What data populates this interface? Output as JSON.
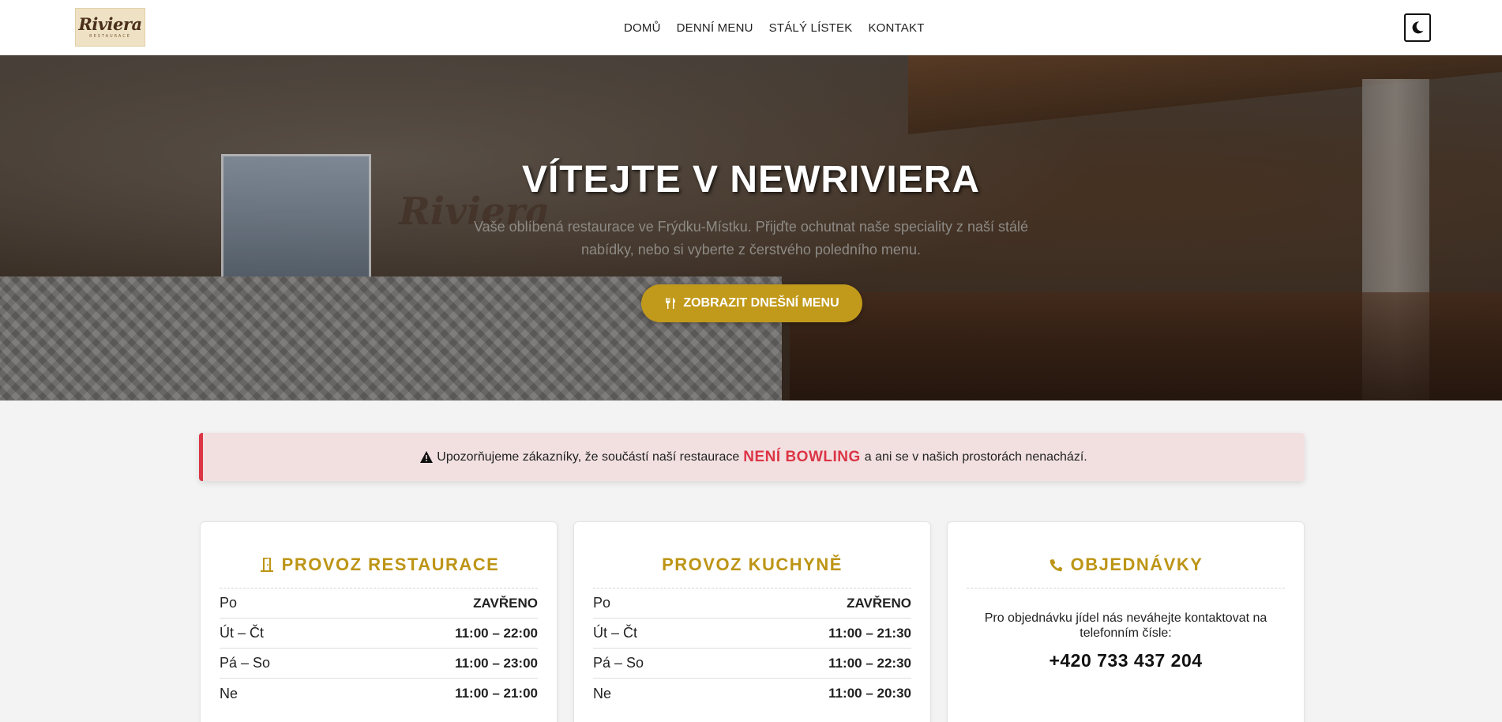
{
  "brand": {
    "logo_text": "Riviera",
    "logo_subtext": "RESTAURACE"
  },
  "nav": {
    "items": [
      "DOMŮ",
      "DENNÍ MENU",
      "STÁLÝ LÍSTEK",
      "KONTAKT"
    ]
  },
  "theme_toggle": {
    "icon": "moon-icon"
  },
  "hero": {
    "background_logo": "Riviera",
    "title": "VÍTEJTE V NEWRIVIERA",
    "subtitle": "Vaše oblíbená restaurace ve Frýdku-Místku. Přijďte ochutnat naše speciality z naší stálé nabídky, nebo si vyberte z čerstvého poledního menu.",
    "button_label": "ZOBRAZIT DNEŠNÍ MENU",
    "button_icon": "utensils-icon",
    "accent_color": "#c29a1b"
  },
  "alert": {
    "text_before": "Upozorňujeme zákazníky, že součástí naší restaurace",
    "emphasis": "NENÍ BOWLING",
    "text_after": "a ani se v našich prostorách nenachází.",
    "icon": "warning-icon",
    "color": "#dc3545"
  },
  "cards": {
    "restaurant": {
      "title": "PROVOZ RESTAURACE",
      "icon": "door-icon",
      "rows": [
        {
          "day": "Po",
          "time": "ZAVŘENO"
        },
        {
          "day": "Út – Čt",
          "time": "11:00 – 22:00"
        },
        {
          "day": "Pá – So",
          "time": "11:00 – 23:00"
        },
        {
          "day": "Ne",
          "time": "11:00 – 21:00"
        }
      ]
    },
    "kitchen": {
      "title": "PROVOZ KUCHYNĚ",
      "rows": [
        {
          "day": "Po",
          "time": "ZAVŘENO"
        },
        {
          "day": "Út – Čt",
          "time": "11:00 – 21:30"
        },
        {
          "day": "Pá – So",
          "time": "11:00 – 22:30"
        },
        {
          "day": "Ne",
          "time": "11:00 – 20:30"
        }
      ]
    },
    "orders": {
      "title": "OBJEDNÁVKY",
      "icon": "phone-icon",
      "text": "Pro objednávku jídel nás neváhejte kontaktovat na telefonním čísle:",
      "phone": "+420 733 437 204"
    }
  },
  "colors": {
    "gold": "#bd9516",
    "danger": "#dc3545"
  }
}
